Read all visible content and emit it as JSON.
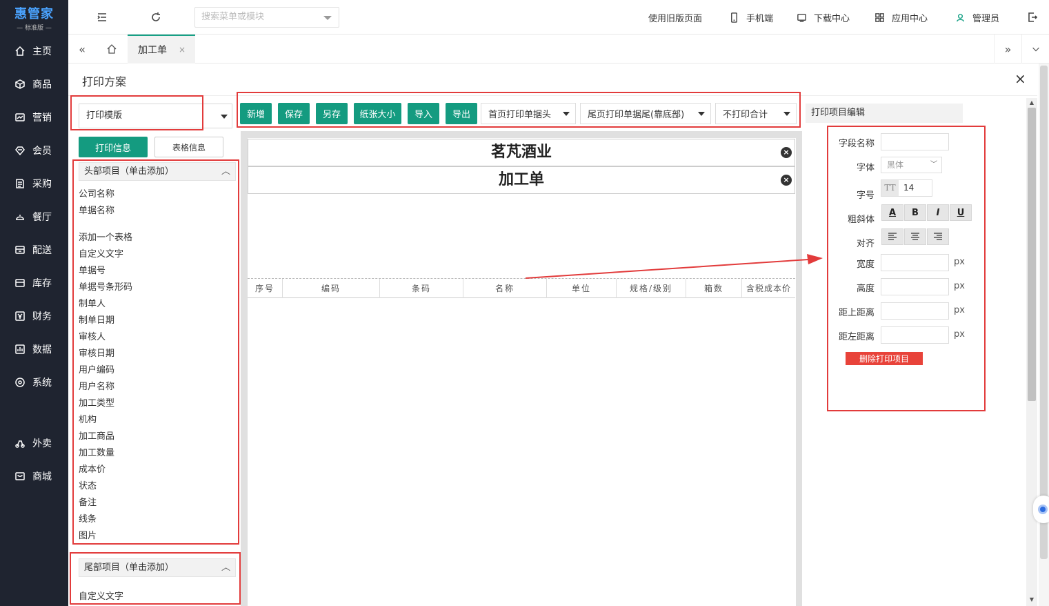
{
  "brand": {
    "name": "惠管家",
    "edition": "— 标准版 —"
  },
  "sidebar": {
    "items": [
      {
        "label": "主页",
        "icon": "home-icon"
      },
      {
        "label": "商品",
        "icon": "box-icon"
      },
      {
        "label": "营销",
        "icon": "marketing-icon"
      },
      {
        "label": "会员",
        "icon": "member-icon"
      },
      {
        "label": "采购",
        "icon": "purchase-icon"
      },
      {
        "label": "餐厅",
        "icon": "restaurant-icon"
      },
      {
        "label": "配送",
        "icon": "delivery-icon"
      },
      {
        "label": "库存",
        "icon": "inventory-icon"
      },
      {
        "label": "财务",
        "icon": "finance-icon"
      },
      {
        "label": "数据",
        "icon": "data-icon"
      },
      {
        "label": "系统",
        "icon": "system-icon"
      },
      {
        "label": "外卖",
        "icon": "takeout-icon"
      },
      {
        "label": "商城",
        "icon": "mall-icon"
      }
    ]
  },
  "topbar": {
    "search_placeholder": "搜索菜单或模块",
    "links": [
      {
        "label": "使用旧版页面"
      },
      {
        "label": "手机端",
        "icon": "mobile-icon"
      },
      {
        "label": "下载中心",
        "icon": "download-icon"
      },
      {
        "label": "应用中心",
        "icon": "apps-icon"
      },
      {
        "label": "管理员",
        "icon": "user-icon"
      }
    ]
  },
  "tabs": {
    "active": "加工单",
    "close": "×"
  },
  "dialog": {
    "title": "打印方案",
    "close": "×"
  },
  "left": {
    "template_select": "打印模版",
    "btn_print_info": "打印信息",
    "btn_table_info": "表格信息",
    "header_panel": "头部项目（单击添加）",
    "header_fields": [
      "公司名称",
      "单据名称",
      "添加一个表格",
      "自定义文字",
      "单据号",
      "单据号条形码",
      "制单人",
      "制单日期",
      "审核人",
      "审核日期",
      "用户编码",
      "用户名称",
      "加工类型",
      "机构",
      "加工商品",
      "加工数量",
      "成本价",
      "状态",
      "备注",
      "线条",
      "图片"
    ],
    "footer_panel": "尾部项目（单击添加）",
    "footer_fields": [
      "自定义文字"
    ]
  },
  "toolbar": {
    "buttons": [
      "新增",
      "保存",
      "另存",
      "纸张大小",
      "导入",
      "导出"
    ],
    "dropdowns": [
      "首页打印单据头",
      "尾页打印单据尾(靠底部)",
      "不打印合计"
    ]
  },
  "canvas": {
    "company": "茗芃酒业",
    "doc_name": "加工单",
    "columns": [
      "序号",
      "编码",
      "条码",
      "名称",
      "单位",
      "规格/级别",
      "箱数",
      "含税成本价"
    ]
  },
  "editor": {
    "title": "打印项目编辑",
    "field_name_label": "字段名称",
    "font_label": "字体",
    "font_value": "黑体",
    "size_label": "字号",
    "size_icon": "TT",
    "size_value": "14",
    "style_label": "粗斜体",
    "style_buttons": [
      "A",
      "B",
      "I",
      "U"
    ],
    "align_label": "对齐",
    "width_label": "宽度",
    "height_label": "高度",
    "top_label": "距上距离",
    "left_label": "距左距离",
    "unit": "px",
    "delete_btn": "删除打印项目"
  },
  "colors": {
    "accent": "#149b80",
    "danger": "#e8433a",
    "annotation": "#e23b3b",
    "sidebar": "#1f2430"
  }
}
